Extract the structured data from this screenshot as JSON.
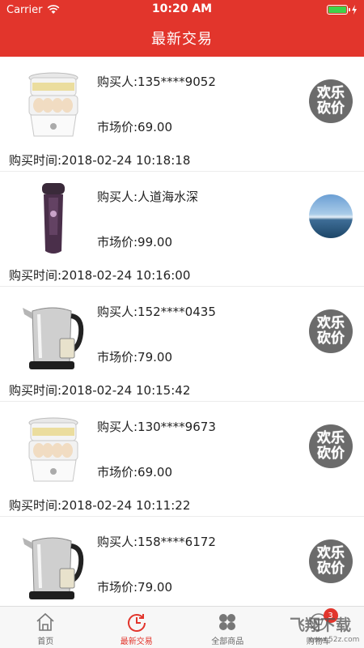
{
  "status_bar": {
    "carrier": "Carrier",
    "time": "10:20 AM"
  },
  "header": {
    "title": "最新交易"
  },
  "transactions": [
    {
      "buyer": "购买人:135****9052",
      "price": "市场价:69.00",
      "time": "购买时间:2018-02-24 10:18:18",
      "product_icon": "egg-steamer-icon",
      "avatar": "badge"
    },
    {
      "buyer": "购买人:人道海水深",
      "price": "市场价:99.00",
      "time": "购买时间:2018-02-24 10:16:00",
      "product_icon": "electric-shaver-icon",
      "avatar": "photo"
    },
    {
      "buyer": "购买人:152****0435",
      "price": "市场价:79.00",
      "time": "购买时间:2018-02-24 10:15:42",
      "product_icon": "electric-kettle-icon",
      "avatar": "badge"
    },
    {
      "buyer": "购买人:130****9673",
      "price": "市场价:69.00",
      "time": "购买时间:2018-02-24 10:11:22",
      "product_icon": "egg-steamer-icon",
      "avatar": "badge"
    },
    {
      "buyer": "购买人:158****6172",
      "price": "市场价:79.00",
      "time": "",
      "product_icon": "electric-kettle-icon",
      "avatar": "badge"
    }
  ],
  "avatar_badge": {
    "line1": "欢乐",
    "line2": "砍价"
  },
  "tabbar": {
    "tabs": [
      {
        "label": "首页",
        "icon": "home-icon"
      },
      {
        "label": "最新交易",
        "icon": "clock-icon",
        "active": true
      },
      {
        "label": "全部商品",
        "icon": "grid-icon"
      },
      {
        "label": "购物车",
        "icon": "cart-icon",
        "badge": "3"
      }
    ]
  },
  "watermark": {
    "text": "飞翔下载",
    "url": "www.52z.com"
  },
  "colors": {
    "brand": "#e2352c",
    "battery": "#3fd24a"
  }
}
